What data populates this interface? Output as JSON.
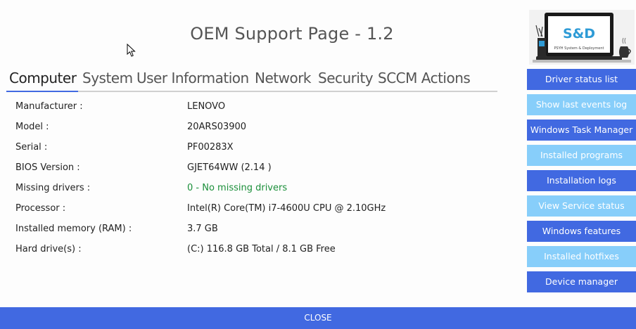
{
  "title": "OEM Support Page - 1.2",
  "tabs": [
    {
      "label": "Computer",
      "active": true
    },
    {
      "label": "System"
    },
    {
      "label": "User Information"
    },
    {
      "label": "Network"
    },
    {
      "label": "Security"
    },
    {
      "label": "SCCM Actions"
    }
  ],
  "computer_info": [
    {
      "label": "Manufacturer :",
      "value": "LENOVO"
    },
    {
      "label": "Model :",
      "value": "20ARS03900"
    },
    {
      "label": "Serial :",
      "value": "PF00283X"
    },
    {
      "label": "BIOS Version :",
      "value": "GJET64WW (2.14 )"
    },
    {
      "label": "Missing drivers :",
      "value": "0 - No missing drivers"
    },
    {
      "label": "Processor :",
      "value": "Intel(R) Core(TM) i7-4600U CPU @ 2.10GHz"
    },
    {
      "label": "Installed memory (RAM) :",
      "value": "3.7 GB"
    },
    {
      "label": "Hard drive(s) :",
      "value": "(C:) 116.8 GB Total / 8.1 GB Free"
    }
  ],
  "logo": {
    "text": "S&D",
    "tagline": "PSYH System & Deployment"
  },
  "side_buttons": [
    {
      "label": "Driver status list",
      "style": "dark"
    },
    {
      "label": "Show last events log",
      "style": "light"
    },
    {
      "label": "Windows Task Manager",
      "style": "dark"
    },
    {
      "label": "Installed programs",
      "style": "light"
    },
    {
      "label": "Installation logs",
      "style": "dark"
    },
    {
      "label": "View Service status",
      "style": "light"
    },
    {
      "label": "Windows features",
      "style": "dark"
    },
    {
      "label": "Installed hotfixes",
      "style": "light"
    },
    {
      "label": "Device manager",
      "style": "dark"
    }
  ],
  "footer": {
    "label": "CLOSE"
  },
  "colors": {
    "accent": "#4169e1",
    "light_button": "#87cefa",
    "success_text": "#1b8f3a"
  }
}
